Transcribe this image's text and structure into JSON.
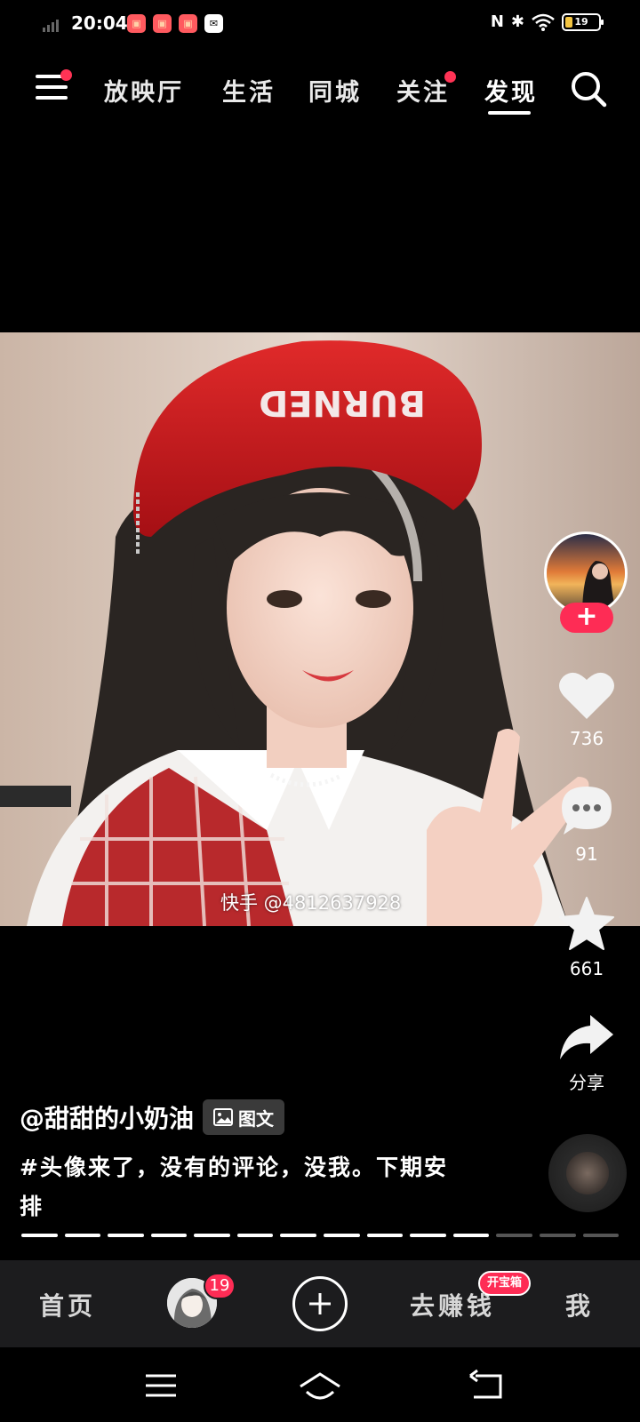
{
  "status_bar": {
    "time": "20:04",
    "app_icons": [
      "kuaishou-icon",
      "kuaishou-icon",
      "kuaishou-icon",
      "message-icon"
    ],
    "icons": [
      "nfc-icon",
      "bluetooth-icon",
      "wifi-icon"
    ],
    "battery": "19"
  },
  "top_nav": {
    "tabs": [
      {
        "label": "放映厅"
      },
      {
        "label": "生活"
      },
      {
        "label": "同城"
      },
      {
        "label": "关注",
        "has_dot": true
      },
      {
        "label": "发现",
        "active": true
      }
    ]
  },
  "photo": {
    "hat_text": "BURNED",
    "watermark": "快手 @4812637928"
  },
  "right_rail": {
    "likes": "736",
    "comments": "91",
    "favorites": "661",
    "share_label": "分享"
  },
  "post": {
    "author": "@甜甜的小奶油",
    "type_badge": "图文",
    "caption": "#头像来了，没有的评论，没我。下期安排"
  },
  "progress": {
    "total_pages": 14,
    "viewed_pages": 11
  },
  "bottom_nav": {
    "home": "首页",
    "avatar_badge": "19",
    "earn": "去赚钱",
    "earn_badge": "开宝箱",
    "me": "我"
  },
  "colors": {
    "accent": "#fe2c55",
    "background": "#000000",
    "nav_bar": "#1c1c1e"
  }
}
